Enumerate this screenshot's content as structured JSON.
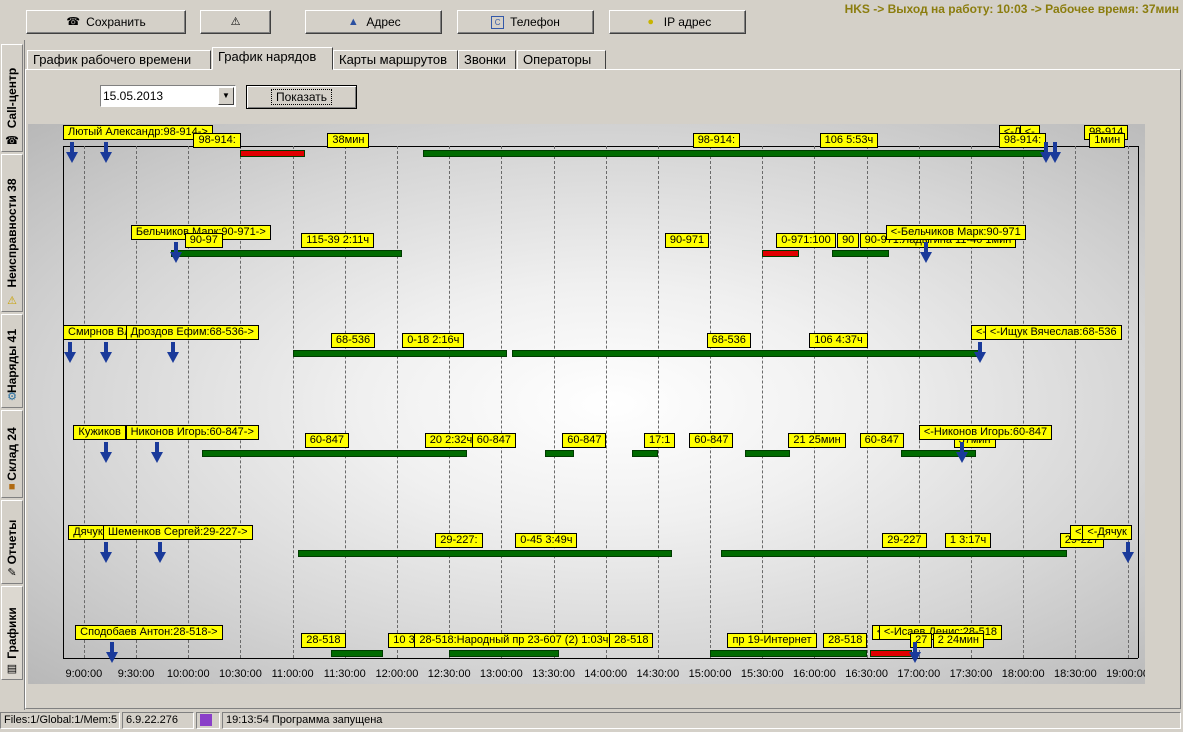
{
  "toolbar": {
    "save_label": "Сохранить",
    "phone_label": "Телефон",
    "address_label": "Адрес",
    "ip_label": "IP адрес"
  },
  "header": {
    "info": "HKS -> Выход на работу: 10:03 -> Рабочее время: 37мин"
  },
  "sidebar": {
    "tabs": [
      "Call-центр",
      "Неисправности 38",
      "Наряды 41",
      "Склад 24",
      "Отчеты",
      "Графики"
    ]
  },
  "tabs": [
    "График рабочего времени",
    "График нарядов",
    "Карты маршрутов",
    "Звонки",
    "Операторы"
  ],
  "filter": {
    "date": "15.05.2013",
    "show_label": "Показать"
  },
  "chart_data": {
    "type": "gantt",
    "x_ticks": [
      "9:00:00",
      "9:30:00",
      "10:00:00",
      "10:30:00",
      "11:00:00",
      "11:30:00",
      "12:00:00",
      "12:30:00",
      "13:00:00",
      "13:30:00",
      "14:00:00",
      "14:30:00",
      "15:00:00",
      "15:30:00",
      "16:00:00",
      "16:30:00",
      "17:00:00",
      "17:30:00",
      "18:00:00",
      "18:30:00",
      "19:00:00"
    ],
    "xlim": [
      "8:48",
      "19:06"
    ],
    "rows": [
      {
        "bars": [
          {
            "start": "10:30",
            "end": "11:07",
            "color": "#e00000"
          },
          {
            "start": "12:15",
            "end": "18:12",
            "color": "#006b00"
          }
        ],
        "labels": [
          {
            "text": "Лютый Александр:98-914->",
            "at": "8:48",
            "dy": 0
          },
          {
            "text": "98-914:",
            "at": "10:03",
            "dy": 10
          },
          {
            "text": "38мин",
            "at": "11:20",
            "dy": 10
          },
          {
            "text": "98-914:",
            "at": "14:50",
            "dy": 10
          },
          {
            "text": "106 5:53ч",
            "at": "16:03",
            "dy": 10
          },
          {
            "text": "<-Л",
            "at": "17:46",
            "dy": 0
          },
          {
            "text": "<-",
            "at": "17:58",
            "dy": 0
          },
          {
            "text": "98-914",
            "at": "18:35",
            "dy": 0
          },
          {
            "text": "98-914:",
            "at": "17:46",
            "dy": 10
          },
          {
            "text": "1мин",
            "at": "18:38",
            "dy": 10
          }
        ],
        "markers": [
          "8:53",
          "9:13",
          "18:13",
          "18:18"
        ]
      },
      {
        "bars": [
          {
            "start": "9:50",
            "end": "12:03",
            "color": "#006b00"
          },
          {
            "start": "15:30",
            "end": "15:51",
            "color": "#e00000"
          },
          {
            "start": "16:10",
            "end": "16:43",
            "color": "#006b00"
          }
        ],
        "labels": [
          {
            "text": "Бельчиков Марк:90-971->",
            "at": "9:27",
            "dy": 0
          },
          {
            "text": "90-97",
            "at": "9:58",
            "dy": 10
          },
          {
            "text": "115-39 2:11ч",
            "at": "11:05",
            "dy": 10
          },
          {
            "text": "90-971",
            "at": "14:34",
            "dy": 10
          },
          {
            "text": "0-971:100",
            "at": "15:38",
            "dy": 10
          },
          {
            "text": "90",
            "at": "16:13",
            "dy": 10
          },
          {
            "text": "90-971:Ладыгина 11-40 1мин",
            "at": "16:26",
            "dy": 10
          },
          {
            "text": "<-Бельчиков Марк:90-971",
            "at": "16:41",
            "dy": 0
          }
        ],
        "markers": [
          "9:53",
          "17:04"
        ]
      },
      {
        "bars": [
          {
            "start": "11:00",
            "end": "13:03",
            "color": "#006b00"
          },
          {
            "start": "13:06",
            "end": "17:35",
            "color": "#006b00"
          }
        ],
        "labels": [
          {
            "text": "Смирнов Влади",
            "at": "8:48",
            "dy": 0
          },
          {
            "text": "Дроздов Ефим:68-536->",
            "at": "9:24",
            "dy": 0
          },
          {
            "text": "68-536",
            "at": "11:22",
            "dy": 10
          },
          {
            "text": "0-18 2:16ч",
            "at": "12:03",
            "dy": 10
          },
          {
            "text": "68-536",
            "at": "14:58",
            "dy": 10
          },
          {
            "text": "106 4:37ч",
            "at": "15:57",
            "dy": 10
          },
          {
            "text": "<-",
            "at": "17:30",
            "dy": 0
          },
          {
            "text": "<-Ищук Вячеслав:68-536",
            "at": "17:38",
            "dy": 0
          }
        ],
        "markers": [
          "8:52",
          "9:13",
          "9:51",
          "17:35"
        ]
      },
      {
        "bars": [
          {
            "start": "10:08",
            "end": "12:40",
            "color": "#006b00"
          },
          {
            "start": "13:25",
            "end": "13:42",
            "color": "#006b00"
          },
          {
            "start": "14:15",
            "end": "14:30",
            "color": "#006b00"
          },
          {
            "start": "15:20",
            "end": "15:46",
            "color": "#006b00"
          },
          {
            "start": "16:50",
            "end": "17:33",
            "color": "#006b00"
          }
        ],
        "labels": [
          {
            "text": "Кужиков",
            "at": "8:54",
            "dy": 0
          },
          {
            "text": "Никонов Игорь:60-847->",
            "at": "9:24",
            "dy": 0
          },
          {
            "text": "60-847",
            "at": "11:07",
            "dy": 10
          },
          {
            "text": "20 2:32ч",
            "at": "12:16",
            "dy": 10
          },
          {
            "text": "60-847",
            "at": "12:43",
            "dy": 10
          },
          {
            "text": "60-847",
            "at": "13:35",
            "dy": 10
          },
          {
            "text": "17:1",
            "at": "14:22",
            "dy": 10
          },
          {
            "text": "60-847",
            "at": "14:48",
            "dy": 10
          },
          {
            "text": "21 25мин",
            "at": "15:45",
            "dy": 10
          },
          {
            "text": "60-847",
            "at": "16:26",
            "dy": 10
          },
          {
            "text": "37мин",
            "at": "17:20",
            "dy": 10
          },
          {
            "text": "<-Никонов Игорь:60-847",
            "at": "17:00",
            "dy": 0
          }
        ],
        "markers": [
          "9:13",
          "9:42",
          "17:25"
        ]
      },
      {
        "bars": [
          {
            "start": "11:03",
            "end": "14:38",
            "color": "#006b00"
          },
          {
            "start": "15:06",
            "end": "18:25",
            "color": "#006b00"
          }
        ],
        "labels": [
          {
            "text": "Дячук",
            "at": "8:51",
            "dy": 0
          },
          {
            "text": "Шеменков Сергей:29-227->",
            "at": "9:11",
            "dy": 0
          },
          {
            "text": "29-227:",
            "at": "12:22",
            "dy": 10
          },
          {
            "text": "0-45 3:49ч",
            "at": "13:08",
            "dy": 10
          },
          {
            "text": "29-227",
            "at": "16:39",
            "dy": 10
          },
          {
            "text": "1 3:17ч",
            "at": "17:15",
            "dy": 10
          },
          {
            "text": "29-227",
            "at": "18:21",
            "dy": 10
          },
          {
            "text": "<-",
            "at": "18:27",
            "dy": 0
          },
          {
            "text": "<-Дячук",
            "at": "18:34",
            "dy": 0
          }
        ],
        "markers": [
          "9:13",
          "9:44",
          "19:00"
        ]
      },
      {
        "bars": [
          {
            "start": "11:22",
            "end": "11:52",
            "color": "#006b00"
          },
          {
            "start": "12:30",
            "end": "13:33",
            "color": "#006b00"
          },
          {
            "start": "15:00",
            "end": "16:30",
            "color": "#006b00"
          },
          {
            "start": "16:32",
            "end": "16:56",
            "color": "#e00000"
          }
        ],
        "labels": [
          {
            "text": "Сподобаев Антон:28-518->",
            "at": "8:55",
            "dy": 0
          },
          {
            "text": "28-518",
            "at": "11:05",
            "dy": 10
          },
          {
            "text": "10 30мин",
            "at": "11:55",
            "dy": 10
          },
          {
            "text": "28-518:Народный пр 23-607 (2) 1:03ч",
            "at": "12:10",
            "dy": 10
          },
          {
            "text": "28-518",
            "at": "14:02",
            "dy": 10
          },
          {
            "text": "пр 19-Интернет",
            "at": "15:10",
            "dy": 10
          },
          {
            "text": "28-518",
            "at": "16:05",
            "dy": 10
          },
          {
            "text": "<-",
            "at": "16:33",
            "dy": 0
          },
          {
            "text": "<-Исаев Денис:28-518",
            "at": "16:37",
            "dy": 0
          },
          {
            "text": "27",
            "at": "16:55",
            "dy": 10
          },
          {
            "text": "2 24мин",
            "at": "17:08",
            "dy": 10
          }
        ],
        "markers": [
          "9:16",
          "16:58"
        ]
      }
    ]
  },
  "status": {
    "files": "Files:1/Global:1/Mem:5",
    "version": "6.9.22.276",
    "message": "19:13:54 Программа запущена"
  }
}
